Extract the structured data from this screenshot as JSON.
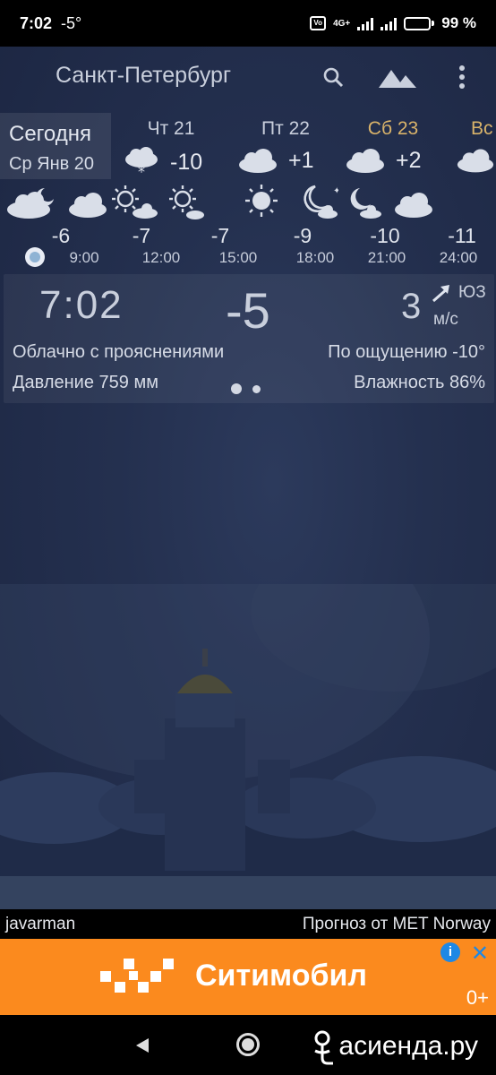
{
  "status": {
    "time": "7:02",
    "temp": "-5°",
    "network": "4G+",
    "battery": "99 %",
    "battery_level": 0.99
  },
  "header": {
    "city": "Санкт-Петербург",
    "icons": [
      "search-icon",
      "landscape-icon",
      "more-vert-icon"
    ]
  },
  "days": {
    "today": {
      "name": "Сегодня",
      "date": "Ср Янв 20"
    },
    "list": [
      {
        "name": "Чт 21",
        "temp": "-10",
        "icon": "cloud-snow-icon",
        "weekend": false
      },
      {
        "name": "Пт 22",
        "temp": "+1",
        "icon": "cloud-icon",
        "weekend": false
      },
      {
        "name": "Сб 23",
        "temp": "+2",
        "icon": "cloud-icon",
        "weekend": true
      },
      {
        "name": "Вс",
        "temp": "",
        "icon": "cloud-icon",
        "weekend": true
      }
    ]
  },
  "hourly": [
    {
      "temp": "-6",
      "time": "9:00",
      "icon": "cloud-moon-icon"
    },
    {
      "temp": "-7",
      "time": "12:00",
      "icon": "cloud-icon"
    },
    {
      "temp": "-7",
      "time": "15:00",
      "icon": "sun-cloud-icon"
    },
    {
      "temp": "-9",
      "time": "18:00",
      "icon": "sun-cloud-icon"
    },
    {
      "temp": "-10",
      "time": "21:00",
      "icon": "sun-icon"
    },
    {
      "temp": "-11",
      "time": "24:00",
      "icon": "moon-cloud-icon"
    },
    {
      "temp": "",
      "time": "",
      "icon": "moon-cloud-icon"
    },
    {
      "temp": "",
      "time": "",
      "icon": "cloud-icon"
    }
  ],
  "current": {
    "time": "7:02",
    "temp": "-5",
    "wind_speed": "3",
    "wind_dir": "ЮЗ",
    "wind_unit": "м/с",
    "description": "Облачно с прояснениями",
    "feels_like": "По ощущению -10°",
    "pressure": "Давление 759 мм",
    "humidity": "Влажность 86%"
  },
  "footer": {
    "user": "javarman",
    "source": "Прогноз от MET Norway"
  },
  "ad": {
    "brand": "Ситимобил",
    "age": "0+",
    "info": "i",
    "close": "✕",
    "color": "#fb8a1e"
  },
  "watermark": "асиенда.ру"
}
